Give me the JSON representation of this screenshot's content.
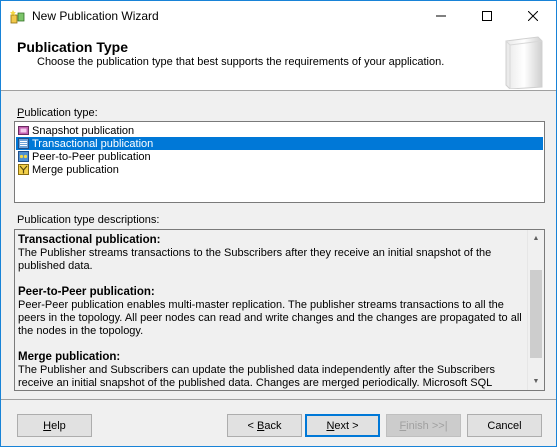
{
  "window": {
    "title": "New Publication Wizard",
    "minimize_icon": "minimize-icon",
    "maximize_icon": "maximize-icon",
    "close_icon": "close-icon"
  },
  "header": {
    "title": "Publication Type",
    "subtitle": "Choose the publication type that best supports the requirements of your application."
  },
  "publication_type": {
    "label_underlined": "P",
    "label_rest": "ublication type:",
    "items": [
      {
        "label": "Snapshot publication",
        "icon": "snapshot-publication-icon",
        "selected": false
      },
      {
        "label": "Transactional publication",
        "icon": "transactional-publication-icon",
        "selected": true
      },
      {
        "label": "Peer-to-Peer publication",
        "icon": "peer-to-peer-publication-icon",
        "selected": false
      },
      {
        "label": "Merge publication",
        "icon": "merge-publication-icon",
        "selected": false
      }
    ]
  },
  "descriptions": {
    "label": "Publication type descriptions:",
    "sections": [
      {
        "heading": "Transactional publication:",
        "text": "The Publisher streams transactions to the Subscribers after they receive an initial snapshot of the published data."
      },
      {
        "heading": "Peer-to-Peer publication:",
        "text": "Peer-Peer publication enables multi-master replication. The publisher streams transactions to all the peers in the topology. All peer nodes can read and write changes and the changes are propagated to all the nodes in the topology."
      },
      {
        "heading": "Merge publication:",
        "text": "The Publisher and Subscribers can update the published data independently after the Subscribers receive an initial snapshot of the published data. Changes are merged periodically. Microsoft SQL Server Compact"
      }
    ]
  },
  "buttons": {
    "help": {
      "pre": "",
      "key": "H",
      "post": "elp"
    },
    "back": {
      "pre": "< ",
      "key": "B",
      "post": "ack"
    },
    "next": {
      "pre": "",
      "key": "N",
      "post": "ext >"
    },
    "finish": {
      "pre": "",
      "key": "F",
      "post": "inish >>|"
    },
    "cancel": {
      "label": "Cancel"
    }
  },
  "colors": {
    "accent": "#0078d7",
    "window_border": "#1883d7"
  }
}
